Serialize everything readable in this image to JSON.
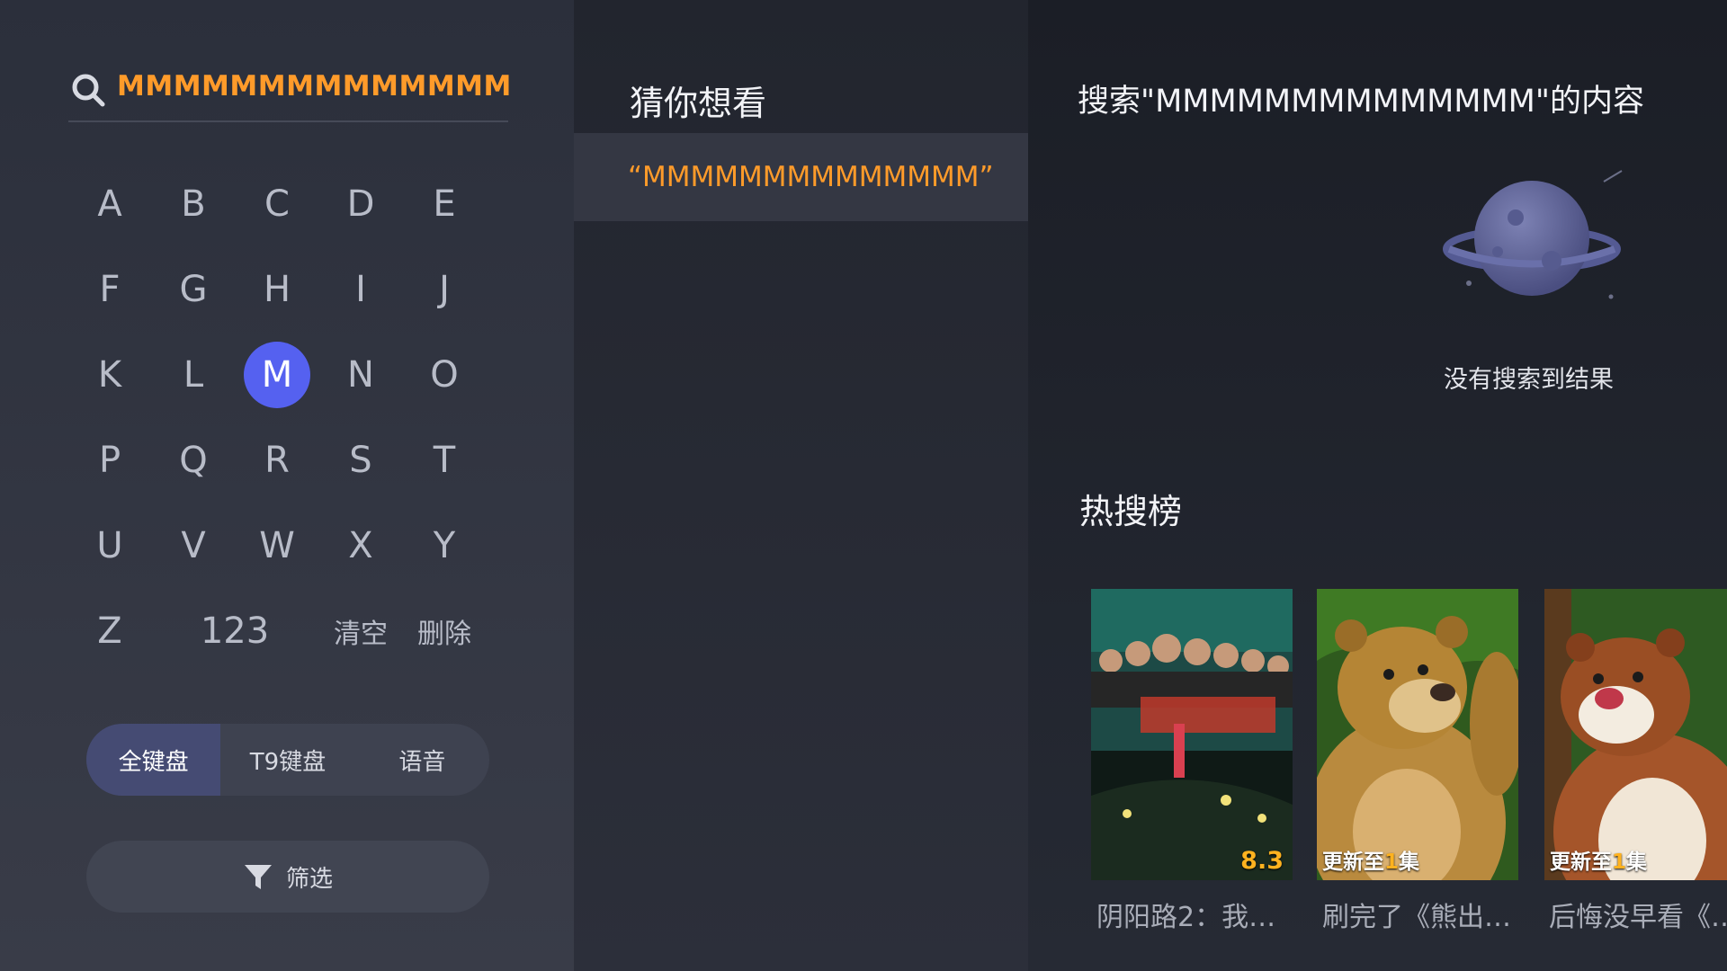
{
  "search": {
    "query": "MMMMMMMMMMMMMM"
  },
  "keyboard": {
    "rows": [
      [
        "A",
        "B",
        "C",
        "D",
        "E"
      ],
      [
        "F",
        "G",
        "H",
        "I",
        "J"
      ],
      [
        "K",
        "L",
        "M",
        "N",
        "O"
      ],
      [
        "P",
        "Q",
        "R",
        "S",
        "T"
      ],
      [
        "U",
        "V",
        "W",
        "X",
        "Y"
      ]
    ],
    "last_row": {
      "z": "Z",
      "num": "123",
      "clear": "清空",
      "delete": "删除"
    },
    "active_key": "M",
    "modes": [
      {
        "label": "全键盘",
        "active": true
      },
      {
        "label": "T9键盘",
        "active": false
      },
      {
        "label": "语音",
        "active": false
      }
    ],
    "filter_label": "筛选"
  },
  "suggestions": {
    "title": "猜你想看",
    "items": [
      "“MMMMMMMMMMMMMM”"
    ]
  },
  "results": {
    "title": "搜索\"MMMMMMMMMMMMMM\"的内容",
    "empty_text": "没有搜索到结果",
    "hot_title": "热搜榜",
    "hot_items": [
      {
        "caption": "阴阳路2：我…",
        "score": "8.3",
        "badge": null
      },
      {
        "caption": "刷完了《熊出…",
        "score": null,
        "badge": {
          "prefix": "更新至",
          "num": "1",
          "suffix": "集"
        }
      },
      {
        "caption": "后悔没早看《…",
        "score": null,
        "badge": {
          "prefix": "更新至",
          "num": "1",
          "suffix": "集"
        }
      }
    ]
  },
  "colors": {
    "accent_orange": "#ff9b2a",
    "key_active": "#5561f0",
    "score_yellow": "#ffb21f"
  }
}
